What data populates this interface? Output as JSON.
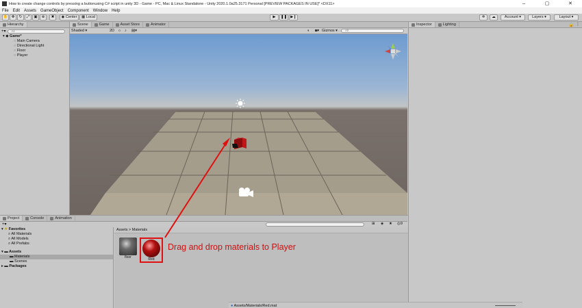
{
  "window": {
    "title": "How to create change controls by pressing a buttonusing C# script in unity 3D - Game - PC, Mac & Linux Standalone - Unity 2020.1.0a25.3171 Personal [PREVIEW PACKAGES IN USE]* <DX11>",
    "buttons": [
      "–",
      "▢",
      "✕"
    ]
  },
  "menu": [
    "File",
    "Edit",
    "Assets",
    "GameObject",
    "Component",
    "Window",
    "Help"
  ],
  "toolbar": {
    "pivot": "Center",
    "space": "Local",
    "account": "Account",
    "layers": "Layers",
    "layout": "Layout"
  },
  "hierarchy": {
    "tab": "Hierarchy",
    "search_placeholder": "All",
    "scene_name": "Game*",
    "items": [
      "Main Camera",
      "Directional Light",
      "Floor",
      "Player"
    ]
  },
  "scene_view": {
    "tabs": [
      "Scene",
      "Game",
      "Asset Store",
      "Animator"
    ],
    "shading": "Shaded",
    "mode_2d": "2D",
    "gizmos": "Gizmos",
    "search_placeholder": "All"
  },
  "inspector": {
    "tabs": [
      "Inspector",
      "Lighting"
    ]
  },
  "project": {
    "tabs": [
      "Project",
      "Console",
      "Animation"
    ],
    "favorites_label": "Favorites",
    "favorites": [
      "All Materials",
      "All Models",
      "All Prefabs"
    ],
    "assets_label": "Assets",
    "asset_folders": [
      "Materials",
      "Scenes"
    ],
    "packages_label": "Packages",
    "breadcrumb": "Assets > Materials",
    "materials": [
      {
        "name": "floor",
        "color": "#6b6b6b"
      },
      {
        "name": "Red",
        "color": "#b01010"
      }
    ],
    "status_path": "Assets/Materials/Red.mat",
    "count": "9"
  },
  "annotation": {
    "text": "Drag and drop materials to Player",
    "color": "#e01010"
  }
}
